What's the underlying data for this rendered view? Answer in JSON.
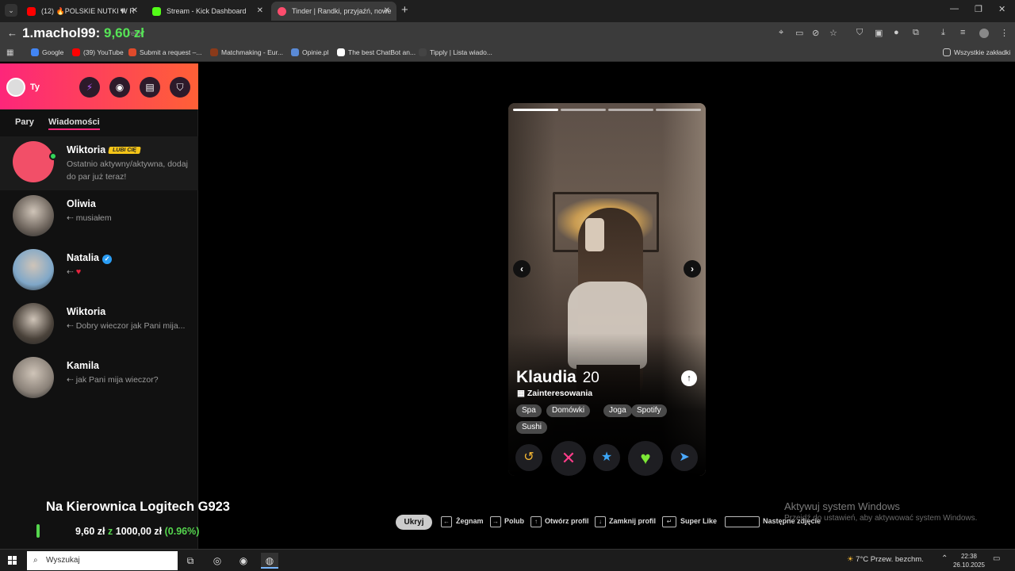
{
  "browser": {
    "tabs": [
      {
        "title": "(12) 🔥POLSKIE NUTKI W R",
        "favicon_color": "#ff0000",
        "active": false
      },
      {
        "title": "Stream - Kick Dashboard",
        "favicon_color": "#53fc18",
        "active": false
      },
      {
        "title": "Tinder | Randki, przyjaźń, nowe",
        "favicon_color": "#fd4d6d",
        "active": true
      }
    ],
    "url_ghost": "recs",
    "overlay_user": "1.machol99:",
    "overlay_amount": "9,60 zł",
    "bookmarks": [
      {
        "label": "Google",
        "color": "#4285f4"
      },
      {
        "label": "(39) YouTube",
        "color": "#ff0000"
      },
      {
        "label": "Submit a request –...",
        "color": "#e04a2b"
      },
      {
        "label": "Matchmaking - Eur...",
        "color": "#8a3a1a"
      },
      {
        "label": "Opinie.pl",
        "color": "#5a8ad6"
      },
      {
        "label": "The best ChatBot an...",
        "color": "#ffffff"
      },
      {
        "label": "Tipply | Lista wiado...",
        "color": "#444444"
      }
    ],
    "all_bookmarks": "Wszystkie zakładki"
  },
  "sidebar": {
    "me_label": "Ty",
    "tabs": [
      "Pary",
      "Wiadomości"
    ],
    "active_tab": "Wiadomości",
    "matches": [
      {
        "name": "Wiktoria",
        "badge": "LUBI CIĘ",
        "message": "Ostatnio aktywny/aktywna, dodaj do par już teraz!",
        "avatar_color": "#f24f68",
        "online": true
      },
      {
        "name": "Oliwia",
        "message": "⇠ musiałem",
        "avatar_color": "#6b625a"
      },
      {
        "name": "Natalia",
        "verified": true,
        "message": "⇠",
        "avatar_color": "#7fa7c8"
      },
      {
        "name": "Wiktoria",
        "message": "⇠ Dobry wieczor jak Pani mija...",
        "avatar_color": "#4a423a"
      },
      {
        "name": "Kamila",
        "message": "⇠ jak Pani mija wieczor?",
        "avatar_color": "#8a8178"
      }
    ]
  },
  "profile": {
    "name": "Klaudia",
    "age": "20",
    "interests_label": "Zainteresowania",
    "interests": [
      "Spa",
      "Domówki",
      "Joga",
      "Spotify",
      "Sushi"
    ],
    "photo_count": 4,
    "current_photo": 1
  },
  "actions": [
    {
      "name": "rewind",
      "glyph": "↺",
      "color": "#f5b733"
    },
    {
      "name": "nope",
      "glyph": "✕",
      "color": "#ff3d8a"
    },
    {
      "name": "super-like",
      "glyph": "★",
      "color": "#3ba5f5"
    },
    {
      "name": "like",
      "glyph": "♥",
      "color": "#7ce836"
    },
    {
      "name": "boost",
      "glyph": "➤",
      "color": "#4aa9ff"
    }
  ],
  "hints": {
    "hide": "Ukryj",
    "nope": "Żegnam",
    "like": "Polub",
    "open_profile": "Otwórz profil",
    "close_profile": "Zamknij profil",
    "super_like": "Super Like",
    "next_photo": "Następne zdjęcie"
  },
  "stream_overlay": {
    "title": "Na Kierownica Logitech G923",
    "current": "9,60 zł",
    "separator": "z",
    "goal": "1000,00 zł",
    "percent": "(0.96%)"
  },
  "windows_activation": {
    "title": "Aktywuj system Windows",
    "subtitle": "Przejdź do ustawień, aby aktywować system Windows."
  },
  "taskbar": {
    "search_placeholder": "Wyszukaj",
    "weather": "7°C  Przew. bezchm.",
    "time": "22:38",
    "date": "26.10.2025"
  }
}
